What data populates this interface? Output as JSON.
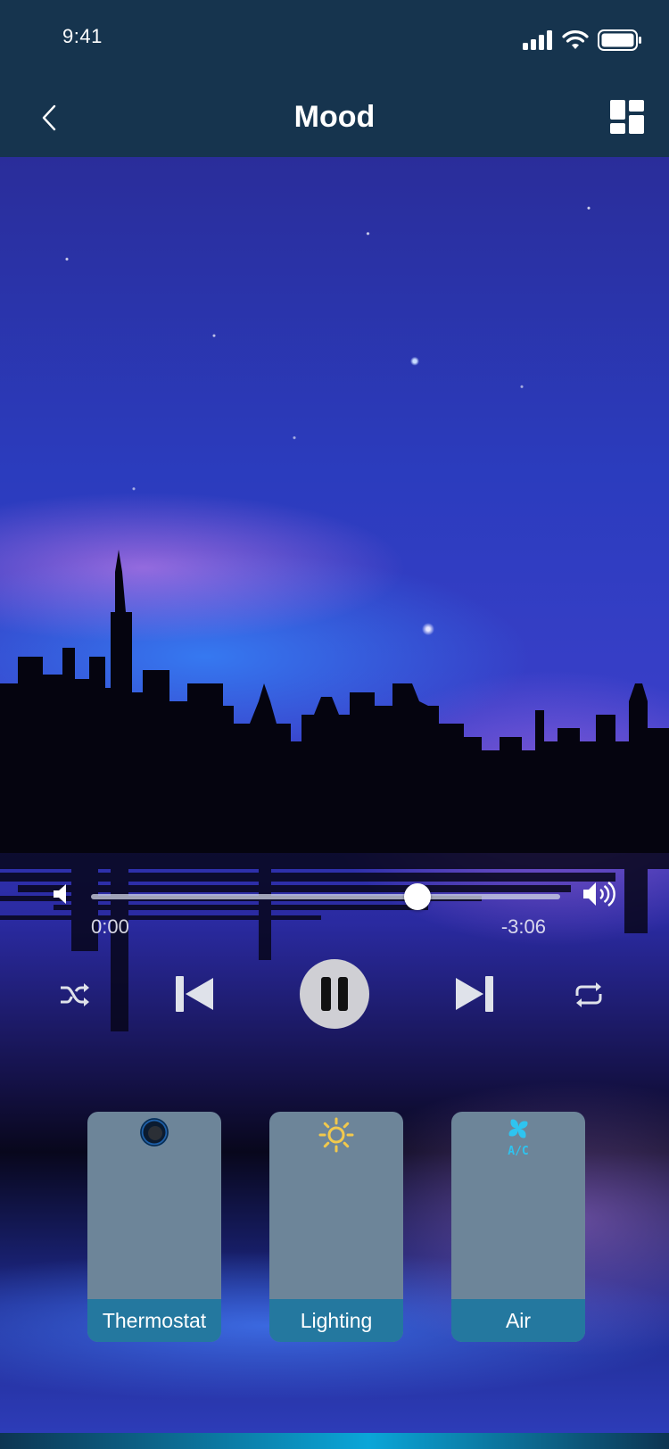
{
  "status_bar": {
    "time": "9:41",
    "icons": [
      "signal-icon",
      "wifi-icon",
      "battery-icon"
    ]
  },
  "nav": {
    "title": "Mood",
    "back_icon": "chevron-left-icon",
    "menu_icon": "grid-icon"
  },
  "player": {
    "elapsed": "0:00",
    "remaining": "-3:06",
    "progress": 0.695,
    "controls": [
      "shuffle-icon",
      "previous-icon",
      "pause-icon",
      "next-icon",
      "repeat-icon"
    ]
  },
  "devices": [
    {
      "label": "Thermostat",
      "icon": "thermostat-icon"
    },
    {
      "label": "Lighting",
      "icon": "sun-icon"
    },
    {
      "label": "Air",
      "icon": "fan-ac-icon",
      "icon_text": "A/C"
    }
  ],
  "colors": {
    "header_bg": "#16344e",
    "card_bg": "#6d8599",
    "card_label_bg": "#24789f",
    "lighting_icon": "#f2c94c",
    "ac_icon": "#2ec4f0"
  }
}
